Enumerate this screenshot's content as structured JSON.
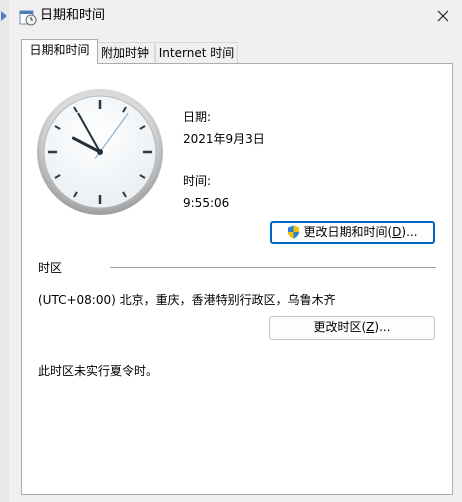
{
  "window": {
    "title": "日期和时间",
    "icon": "date-time-icon",
    "close_icon": "close-icon"
  },
  "tabs": [
    {
      "label": "日期和时间",
      "selected": true
    },
    {
      "label": "附加时钟",
      "selected": false
    },
    {
      "label": "Internet 时间",
      "selected": false
    }
  ],
  "date_time": {
    "date_label": "日期:",
    "date_value": "2021年9月3日",
    "time_label": "时间:",
    "time_value": "9:55:06",
    "change_button": {
      "text": "更改日期和时间(",
      "accel": "D",
      "suffix": ")...",
      "icon": "shield-icon"
    }
  },
  "clock": {
    "hours": 9,
    "minutes": 55,
    "seconds": 6
  },
  "timezone": {
    "section_label": "时区",
    "value": "(UTC+08:00) 北京，重庆，香港特别行政区，乌鲁木齐",
    "change_button": {
      "text": "更改时区(",
      "accel": "Z",
      "suffix": ")..."
    },
    "dst_note": "此时区未实行夏令时。"
  },
  "colors": {
    "accent": "#0067c0",
    "dialog_bg": "#f0f0f0",
    "panel_bg": "#ffffff"
  }
}
